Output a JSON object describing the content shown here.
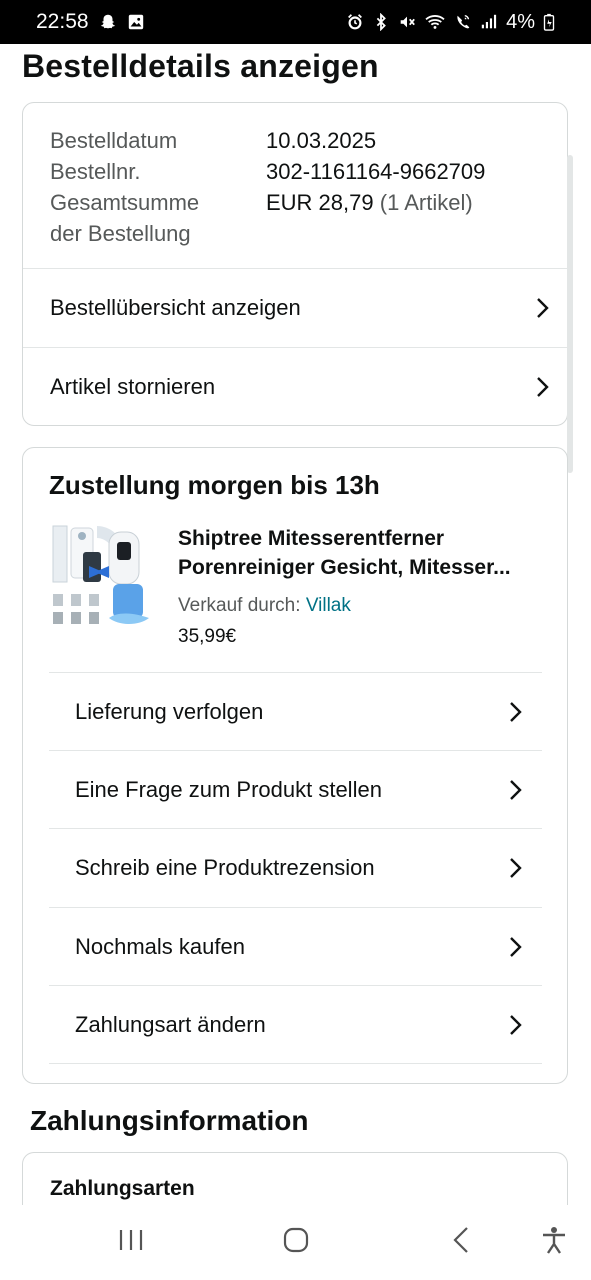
{
  "status_bar": {
    "time": "22:58",
    "battery": "4%",
    "left_icons": [
      "snapchat-icon",
      "image-icon"
    ],
    "right_icons": [
      "alarm-icon",
      "bluetooth-icon",
      "mute-icon",
      "wifi-icon",
      "wifi-call-icon",
      "signal-icon",
      "battery-icon"
    ]
  },
  "page": {
    "title": "Bestelldetails anzeigen"
  },
  "summary": {
    "rows": [
      {
        "label": "Bestelldatum",
        "value": "10.03.2025"
      },
      {
        "label": "Bestellnr.",
        "value": "302-1161164-9662709"
      },
      {
        "label_line1": "Gesamtsumme",
        "label_line2": "der Bestellung",
        "value": "EUR 28,79",
        "value_suffix": "(1 Artikel)"
      }
    ],
    "actions": [
      {
        "label": "Bestellübersicht anzeigen"
      },
      {
        "label": "Artikel stornieren"
      }
    ]
  },
  "shipment": {
    "title": "Zustellung morgen bis 13h",
    "product": {
      "name_line1": "Shiptree Mitesserentferner",
      "name_line2": "Porenreiniger Gesicht, Mitesser...",
      "seller_label": "Verkauf durch:",
      "seller_name": "Villak",
      "price": "35,99€"
    },
    "actions": [
      {
        "label": "Lieferung verfolgen"
      },
      {
        "label": "Eine Frage zum Produkt stellen"
      },
      {
        "label": "Schreib eine Produktrezension"
      },
      {
        "label": "Nochmals kaufen"
      },
      {
        "label": "Zahlungsart ändern"
      }
    ]
  },
  "payment": {
    "section_title": "Zahlungsinformation",
    "card_label": "Zahlungsarten"
  },
  "nav_bar": {
    "icons": [
      "recent-apps-icon",
      "home-icon",
      "back-icon",
      "accessibility-icon"
    ]
  },
  "colors": {
    "link": "#007185",
    "text": "#0f1111",
    "muted": "#565959",
    "border": "#d5d9d9"
  }
}
